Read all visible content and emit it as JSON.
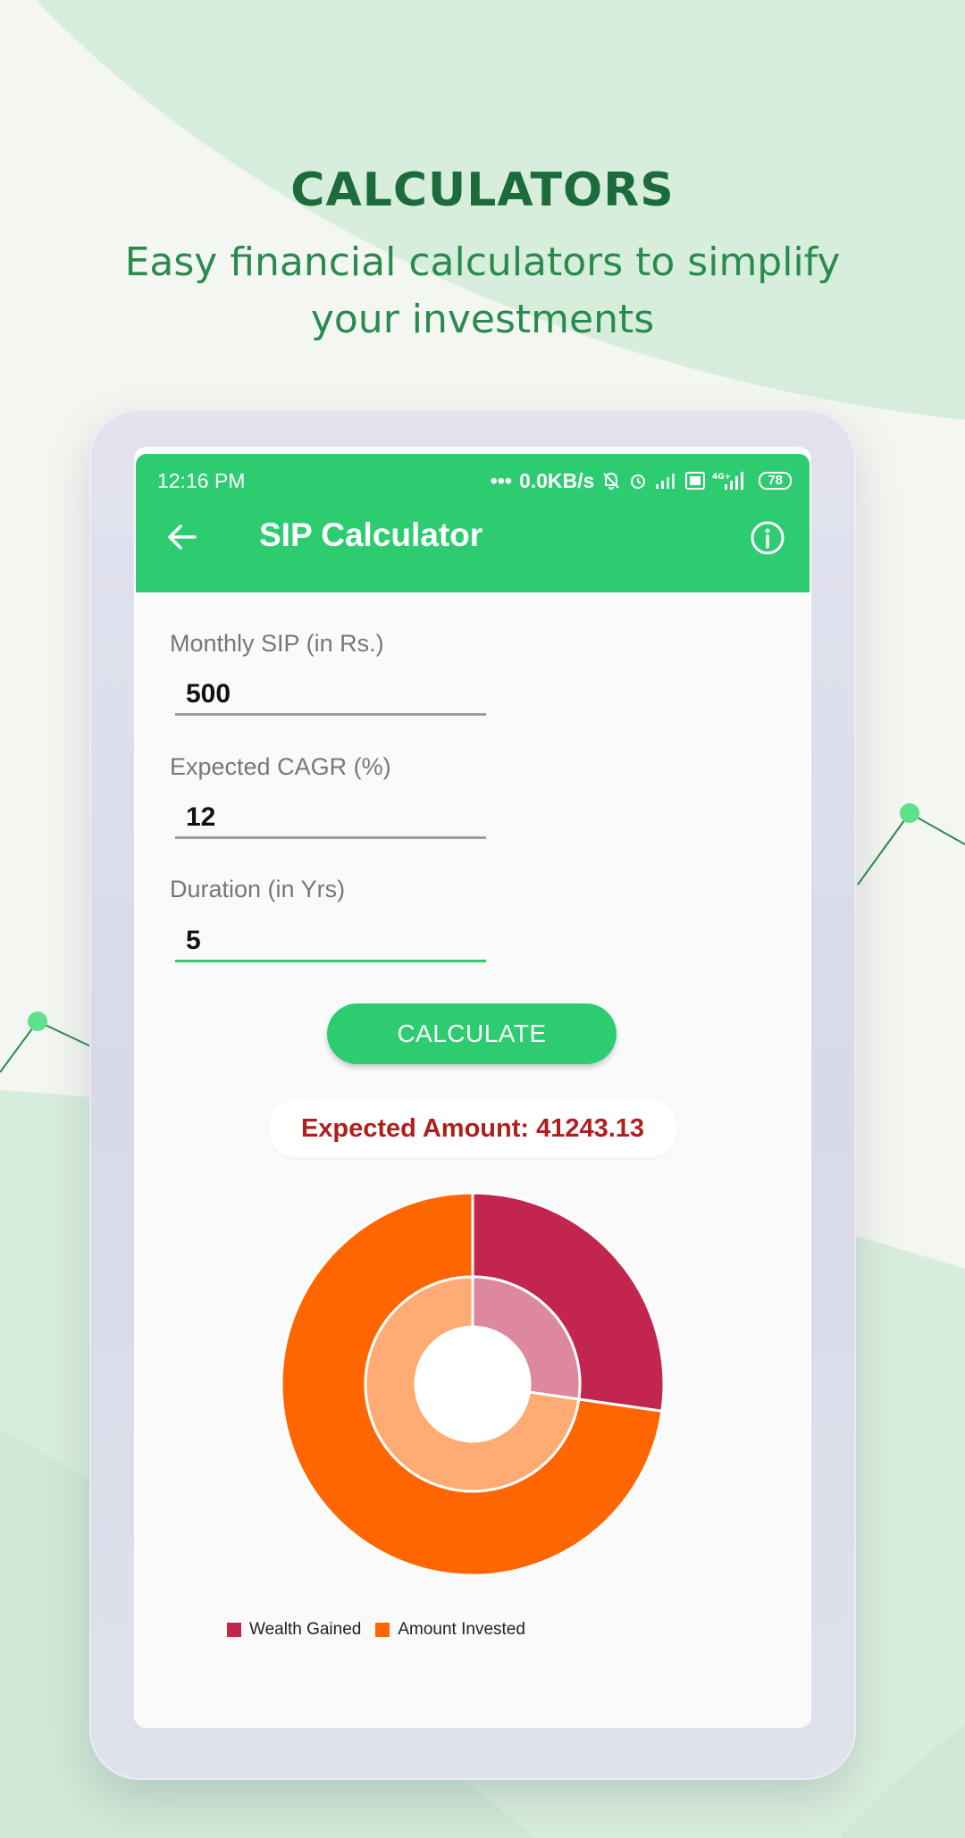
{
  "hero": {
    "title": "CALCULATORS",
    "subtitle_line1": "Easy financial calculators to simplify",
    "subtitle_line2": "your investments"
  },
  "status_bar": {
    "time": "12:16 PM",
    "network_speed": "0.0KB/s",
    "battery": "78",
    "icons": [
      "more-dots-icon",
      "mute-bell-icon",
      "alarm-icon",
      "signal-icon",
      "volte-icon",
      "4g-signal-icon",
      "battery-icon"
    ]
  },
  "toolbar": {
    "title": "SIP Calculator",
    "back_icon": "arrow-left-icon",
    "info_icon": "info-circle-icon"
  },
  "form": {
    "monthly_sip_label": "Monthly SIP (in Rs.)",
    "monthly_sip_value": "500",
    "cagr_label": "Expected CAGR (%)",
    "cagr_value": "12",
    "duration_label": "Duration (in Yrs)",
    "duration_value": "5"
  },
  "calculate_label": "CALCULATE",
  "result": {
    "text": "Expected Amount: 41243.13"
  },
  "chart_data": {
    "type": "pie",
    "categories": [
      "Wealth Gained",
      "Amount Invested"
    ],
    "values": [
      11243.13,
      30000
    ],
    "colors": [
      "#c2264f",
      "#ff6600"
    ],
    "legend_position": "bottom-left",
    "style": "donut with lighter inner ring"
  },
  "colors": {
    "accent": "#2ecc71",
    "result_text": "#b01e1e",
    "hero_title": "#1c6b3c"
  }
}
